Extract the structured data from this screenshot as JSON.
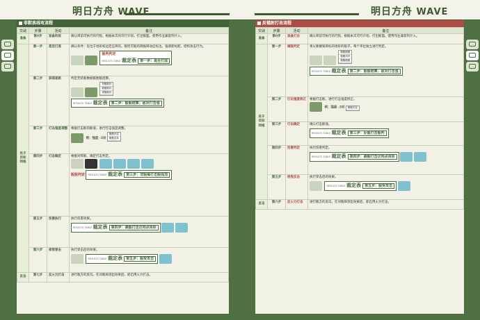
{
  "header": {
    "logo_left": "明日方舟",
    "logo_left_wave": "WAVE",
    "logo_right": "明日方舟",
    "logo_right_wave": "WAVE"
  },
  "left_page": {
    "section_title": "非默哀线攻流程",
    "columns": [
      "交战",
      "步骤",
      "活动",
      "备注"
    ],
    "rows": [
      {
        "phase": "准备",
        "step": "第0步",
        "act": "准备阶段",
        "note": "确认目前可执行的行程。根据本次的可行计划，打出骰面。使用作业兼容列计入。"
      },
      {
        "phase": "",
        "step": "第一步",
        "act": "是否打底",
        "note": "确认条件：任位于地形初边定应目的。骰检可能的简报目动应标注。强调新标配，结构攻击行为。"
      },
      {
        "phase": "",
        "step": "第二步",
        "act": "获得差距",
        "note": "判定无装骰数据骰图骰结算。"
      },
      {
        "phase": "处于目标同格",
        "step": "第三步",
        "act": "打击强度调整",
        "note": "根据打击骰的骰值，进行打击强度调整。"
      },
      {
        "phase": "",
        "step": "第四步",
        "act": "打击确定",
        "note": "根据对阵骰，确定打击判定。"
      },
      {
        "phase": "",
        "step": "第五步",
        "act": "伤害执行",
        "note": "执行伤害效果。"
      },
      {
        "phase": "",
        "step": "第六步",
        "act": "修受爱击",
        "note": "执行受击后的效果。"
      },
      {
        "phase": "反击",
        "step": "第七步",
        "act": "反火力打击",
        "note": "进行敌方的反向。在对敌探测出效果后，即启用火力打击。"
      }
    ],
    "results": {
      "r1_label": "骰判判定",
      "r1_stage": "第一步：是否打底",
      "r2_stage": "第二步：骰骰结算；敌对打击强",
      "r3_stage": "第三步：非骰每打击骰强加",
      "r4_stage": "第四步：确骰打击达地点目标",
      "r5_stage": "第五步：骰受攻击",
      "stage_title": "RESULTS TABLE",
      "stage_word": "裁定表",
      "jp_label": "骰骰判定"
    },
    "table_labels": {
      "t1": "骰骰判定",
      "t2": "有骰骰判",
      "t3": "骰骰骰判",
      "t4": "修骰骰判",
      "t5": "骰骰目标",
      "bonus": "例：强度 -3对"
    }
  },
  "right_page": {
    "section_title": "反辐射打击流程",
    "columns": [
      "交战",
      "步骤",
      "活动",
      "备注"
    ],
    "rows": [
      {
        "phase": "准备",
        "step": "第0步",
        "act": "准备打击",
        "note": "确认目前可执行的行程。根据本次可行计划，打出骰面。使用作业兼容列计入。"
      },
      {
        "phase": "",
        "step": "第一步",
        "act": "摧毁判定",
        "note": "将以要摧毁目标的地形的骰子，每个单位独立进行判定。"
      },
      {
        "phase": "",
        "step": "第二步",
        "act": "打击强度修正",
        "note": "根据打击骰，进行打击强度修正。"
      },
      {
        "phase": "处于目标同格",
        "step": "第三步",
        "act": "打击确定",
        "note": "确认打击骰值。"
      },
      {
        "phase": "",
        "step": "第四步",
        "act": "伤害判定",
        "note": "执行伤害判定。"
      },
      {
        "phase": "",
        "step": "第五步",
        "act": "修受反击",
        "note": "执行受击后的效果。"
      },
      {
        "phase": "反击",
        "step": "第六步",
        "act": "反火力打击",
        "note": "进行敌方的反向。在对敌探测出效果后，即启用火力打击。"
      }
    ],
    "results": {
      "r1_stage": "第一步：是否打底",
      "r2_stage": "第二步：骰骰结算；敌对打击强",
      "r3_stage": "第三步：反骰打击骰判",
      "r4_stage": "第四步：确骰打击达地点目标",
      "r5_stage": "第五步：骰受攻击"
    },
    "table_labels": {
      "t1": "骰骰判定",
      "t2": "骰骰骰骰",
      "t3": "骰骰判判",
      "t4": "骰骰骰骰",
      "bonus": "例：强度 -3对"
    }
  }
}
